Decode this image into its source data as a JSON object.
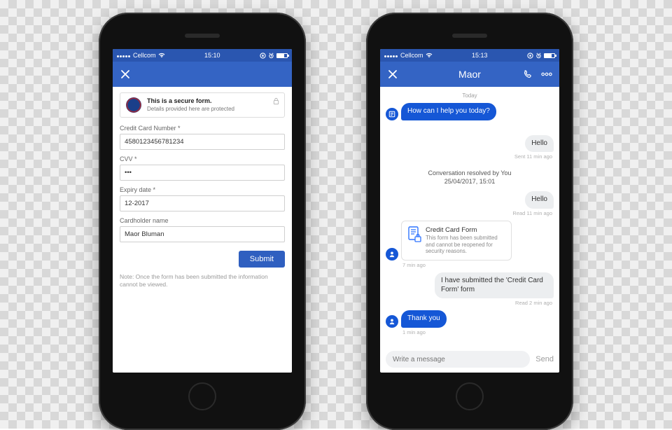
{
  "colors": {
    "header": "#3464c4",
    "status": "#2a56b0",
    "accent": "#1557d6"
  },
  "phoneA": {
    "status": {
      "carrier": "Cellcom",
      "time": "15:10"
    },
    "secure": {
      "title": "This is a secure form.",
      "sub": "Details provided here are protected"
    },
    "fields": {
      "cc_label": "Credit Card Number *",
      "cc_value": "4580123456781234",
      "cvv_label": "CVV *",
      "cvv_value": "•••",
      "exp_label": "Expiry date *",
      "exp_value": "12-2017",
      "name_label": "Cardholder name",
      "name_value": "Maor Bluman"
    },
    "submit_label": "Submit",
    "note": "Note: Once the form has been submitted the information cannot be viewed."
  },
  "phoneB": {
    "status": {
      "carrier": "Cellcom",
      "time": "15:13"
    },
    "header_title": "Maor",
    "day": "Today",
    "msgs": {
      "m0": {
        "text": "How can I help you today?"
      },
      "m1": {
        "text": "Hello",
        "meta": "Sent  11 min ago"
      },
      "resolved_a": "Conversation resolved by You",
      "resolved_b": "25/04/2017, 15:01",
      "m2": {
        "text": "Hello",
        "meta": "Read  11 min ago"
      },
      "form_card": {
        "title": "Credit Card Form",
        "sub": "This form has been submitted and cannot be reopened for security reasons.",
        "meta": "7 min ago"
      },
      "m3": {
        "text": "I have submitted the 'Credit Card Form' form",
        "meta": "Read  2 min ago"
      },
      "m4": {
        "text": "Thank you",
        "meta": "1 min ago"
      }
    },
    "composer": {
      "placeholder": "Write a message",
      "send": "Send"
    }
  }
}
